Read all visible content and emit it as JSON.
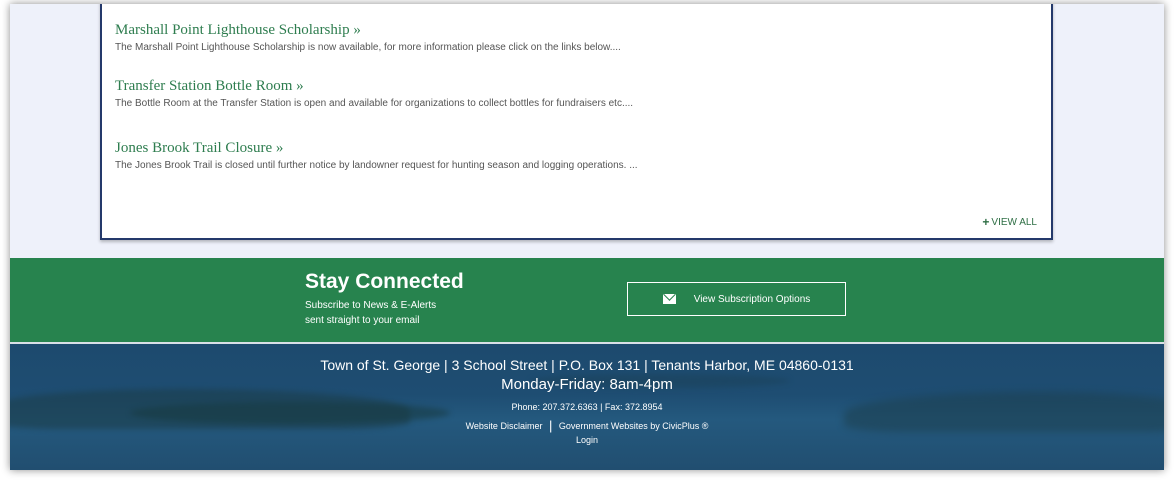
{
  "news": {
    "items": [
      {
        "title": "Marshall Point Lighthouse Scholarship  »",
        "desc": "The Marshall Point Lighthouse Scholarship is now available, for more information please click on the links below...."
      },
      {
        "title": "Transfer Station Bottle Room  »",
        "desc": "The Bottle Room at the Transfer Station is open and available for organizations to collect bottles for fundraisers etc...."
      },
      {
        "title": "Jones Brook Trail Closure »",
        "desc": "The Jones Brook Trail is closed until further notice by landowner request for hunting season and logging operations. ..."
      }
    ],
    "view_all_label": "VIEW ALL"
  },
  "stay_connected": {
    "title": "Stay Connected",
    "subtitle_line1": "Subscribe to News & E-Alerts",
    "subtitle_line2": "sent straight to your email",
    "button_label": "View Subscription Options"
  },
  "footer": {
    "address": "Town of St. George | 3 School Street | P.O. Box 131 | Tenants Harbor, ME 04860-0131",
    "hours": "Monday-Friday: 8am-4pm",
    "phone": "Phone: 207.372.6363 | Fax: 372.8954",
    "disclaimer_link": "Website Disclaimer",
    "separator": "|",
    "civicplus_link": "Government Websites by CivicPlus ®",
    "login_link": "Login"
  },
  "colors": {
    "accent_green": "#27834e",
    "title_green": "#2e7d4f",
    "card_border": "#24396b",
    "footer_blue": "#1e4d72"
  },
  "icons": {
    "view_all": "plus-icon",
    "subscribe": "envelope-icon"
  }
}
